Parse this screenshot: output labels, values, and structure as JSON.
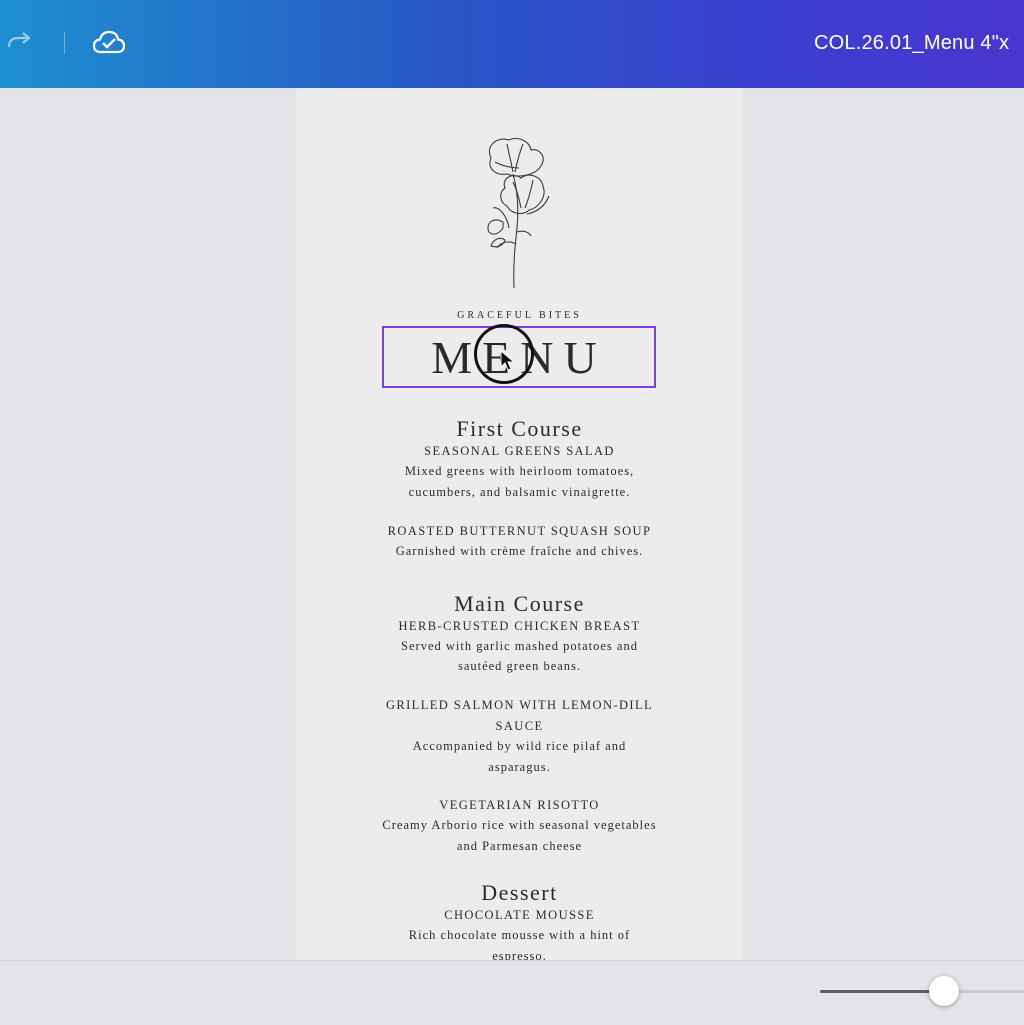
{
  "document": {
    "title": "COL.26.01_Menu 4\"x"
  },
  "menu": {
    "brand": "GRACEFUL BITES",
    "title": "MENU",
    "first_course": {
      "heading": "First Course",
      "items": [
        {
          "name": "SEASONAL GREENS SALAD",
          "desc": [
            "Mixed greens with heirloom tomatoes,",
            "cucumbers, and balsamic vinaigrette."
          ]
        },
        {
          "name": "ROASTED BUTTERNUT SQUASH SOUP",
          "desc": [
            "Garnished with crème fraîche and chives."
          ]
        }
      ]
    },
    "main_course": {
      "heading": "Main Course",
      "items": [
        {
          "name": "HERB-CRUSTED CHICKEN BREAST",
          "desc": [
            "Served with garlic mashed potatoes and",
            "sautéed green beans."
          ]
        },
        {
          "name_lines": [
            "GRILLED SALMON WITH LEMON-DILL",
            "SAUCE"
          ],
          "desc": [
            "Accompanied by wild rice pilaf and",
            "asparagus."
          ]
        },
        {
          "name": "VEGETARIAN RISOTTO",
          "desc": [
            "Creamy Arborio rice with seasonal vegetables",
            "and Parmesan cheese"
          ]
        }
      ]
    },
    "dessert": {
      "heading": "Dessert",
      "items": [
        {
          "name": "CHOCOLATE MOUSSE",
          "desc": [
            "Rich chocolate mousse with a hint of",
            "espresso."
          ]
        }
      ]
    }
  },
  "zoom": {
    "level": 0.61
  },
  "colors": {
    "selection": "#7d3fdc",
    "header_start": "#1d8fd0",
    "header_end": "#4a35cf"
  },
  "icons": {
    "redo": "redo-icon",
    "cloud": "cloud-saved-icon",
    "illustration": "poppy-flower-illustration"
  }
}
